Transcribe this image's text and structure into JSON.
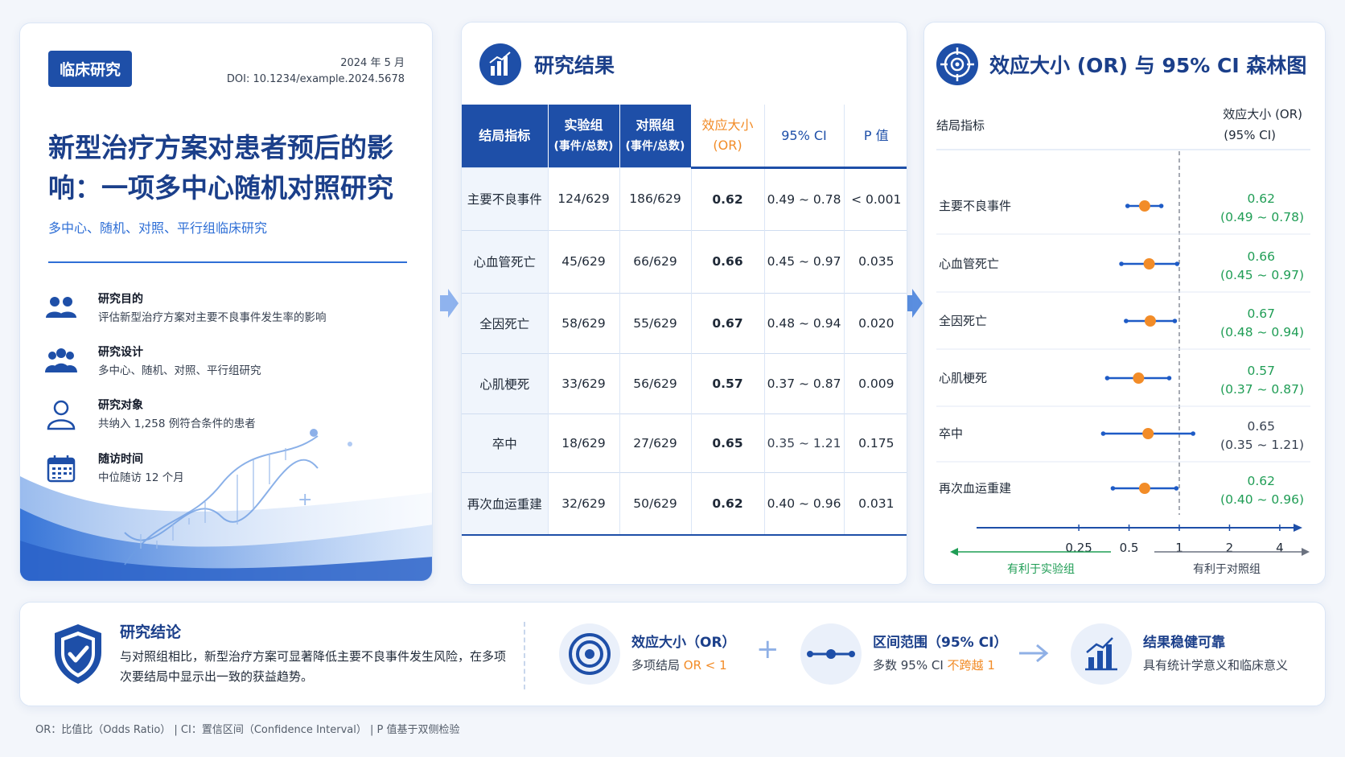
{
  "left": {
    "badge": "临床研究",
    "date": "2024 年 5 月",
    "doi": "DOI: 10.1234/example.2024.5678",
    "title": "新型治疗方案对患者预后的影响：一项多中心随机对照研究",
    "subtitle": "多中心、随机、对照、平行组临床研究",
    "items": [
      {
        "icon": "people-icon",
        "title": "研究目的",
        "text": "评估新型治疗方案对主要不良事件发生率的影响"
      },
      {
        "icon": "group-icon",
        "title": "研究设计",
        "text": "多中心、随机、对照、平行组研究"
      },
      {
        "icon": "person-icon",
        "title": "研究对象",
        "text": "共纳入 1,258 例符合条件的患者"
      },
      {
        "icon": "calendar-icon",
        "title": "随访时间",
        "text": "中位随访 12 个月"
      }
    ]
  },
  "results": {
    "title": "研究结果",
    "headers": {
      "outcome": "结局指标",
      "exp_1": "实验组",
      "exp_2": "(事件/总数)",
      "ctrl_1": "对照组",
      "ctrl_2": "(事件/总数)",
      "or_1": "效应大小",
      "or_2": "(OR)",
      "ci": "95% CI",
      "p": "P 值"
    },
    "rows": [
      {
        "outcome": "主要不良事件",
        "exp": "124/629",
        "ctrl": "186/629",
        "or": "0.62",
        "ci": "0.49 ~ 0.78",
        "p": "< 0.001"
      },
      {
        "outcome": "心血管死亡",
        "exp": "45/629",
        "ctrl": "66/629",
        "or": "0.66",
        "ci": "0.45 ~ 0.97",
        "p": "0.035"
      },
      {
        "outcome": "全因死亡",
        "exp": "58/629",
        "ctrl": "55/629",
        "or": "0.67",
        "ci": "0.48 ~ 0.94",
        "p": "0.020"
      },
      {
        "outcome": "心肌梗死",
        "exp": "33/629",
        "ctrl": "56/629",
        "or": "0.57",
        "ci": "0.37 ~ 0.87",
        "p": "0.009"
      },
      {
        "outcome": "卒中",
        "exp": "18/629",
        "ctrl": "27/629",
        "or": "0.65",
        "ci": "0.35 ~ 1.21",
        "p": "0.175"
      },
      {
        "outcome": "再次血运重建",
        "exp": "32/629",
        "ctrl": "50/629",
        "or": "0.62",
        "ci": "0.40 ~ 0.96",
        "p": "0.031"
      }
    ]
  },
  "forest": {
    "title": "效应大小 (OR) 与 95% CI 森林图",
    "col_outcome": "结局指标",
    "col_effect_1": "效应大小 (OR)",
    "col_effect_2": "(95% CI)",
    "favor_left": "有利于实验组",
    "favor_right": "有利于对照组",
    "ticks": [
      "0.25",
      "0.5",
      "1",
      "2",
      "4"
    ]
  },
  "chart_data": {
    "type": "scatter",
    "xscale": "log",
    "xlim": [
      0.2,
      5
    ],
    "reference_line": 1,
    "categories": [
      "主要不良事件",
      "心血管死亡",
      "全因死亡",
      "心肌梗死",
      "卒中",
      "再次血运重建"
    ],
    "values": [
      0.62,
      0.66,
      0.67,
      0.57,
      0.65,
      0.62
    ],
    "ci_low": [
      0.49,
      0.45,
      0.48,
      0.37,
      0.35,
      0.4
    ],
    "ci_high": [
      0.78,
      0.97,
      0.94,
      0.87,
      1.21,
      0.96
    ],
    "point_color": "#f28c28",
    "line_color": "#1e5bc6",
    "significant_color": "#1f9d55",
    "neutral_color": "#374151"
  },
  "conclusion": {
    "title": "研究结论",
    "text": "与对照组相比，新型治疗方案可显著降低主要不良事件发生风险，在多项次要结局中显示出一致的获益趋势。",
    "s1_title": "效应大小（OR）",
    "s1_pre": "多项结局 ",
    "s1_hl": "OR < 1",
    "s2_title": "区间范围（95% CI）",
    "s2_pre": "多数 95% CI ",
    "s2_hl": "不跨越 1",
    "s3_title": "结果稳健可靠",
    "s3_text": "具有统计学意义和临床意义"
  },
  "footnote": "OR：比值比（Odds Ratio）  |  CI：置信区间（Confidence Interval）  |  P 值基于双侧检验",
  "colors": {
    "primary": "#1e4fa8",
    "accent": "#f28c28",
    "success": "#1f9d55"
  }
}
